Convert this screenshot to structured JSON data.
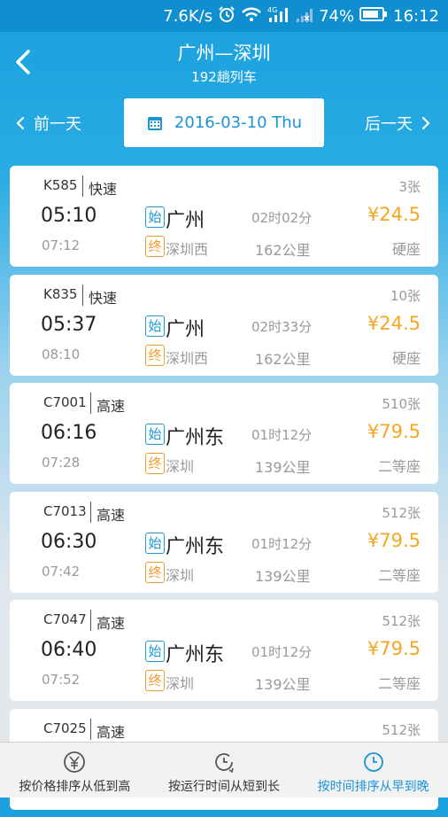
{
  "status_bar": {
    "speed": "7.6K/s",
    "battery": "74%",
    "time": "16:12"
  },
  "header": {
    "title": "广州—深圳",
    "subtitle": "192趟列车"
  },
  "date_nav": {
    "prev_label": "前一天",
    "date": "2016-03-10 Thu",
    "next_label": "后一天"
  },
  "trains": [
    {
      "number": "K585",
      "type": "快速",
      "tickets": "3张",
      "depart": "05:10",
      "arrive": "07:12",
      "start_badge": "始",
      "end_badge": "终",
      "from": "广州",
      "to": "深圳西",
      "duration": "02时02分",
      "distance": "162公里",
      "price": "¥24.5",
      "seat": "硬座"
    },
    {
      "number": "K835",
      "type": "快速",
      "tickets": "10张",
      "depart": "05:37",
      "arrive": "08:10",
      "start_badge": "始",
      "end_badge": "终",
      "from": "广州",
      "to": "深圳西",
      "duration": "02时33分",
      "distance": "162公里",
      "price": "¥24.5",
      "seat": "硬座"
    },
    {
      "number": "C7001",
      "type": "高速",
      "tickets": "510张",
      "depart": "06:16",
      "arrive": "07:28",
      "start_badge": "始",
      "end_badge": "终",
      "from": "广州东",
      "to": "深圳",
      "duration": "01时12分",
      "distance": "139公里",
      "price": "¥79.5",
      "seat": "二等座"
    },
    {
      "number": "C7013",
      "type": "高速",
      "tickets": "512张",
      "depart": "06:30",
      "arrive": "07:42",
      "start_badge": "始",
      "end_badge": "终",
      "from": "广州东",
      "to": "深圳",
      "duration": "01时12分",
      "distance": "139公里",
      "price": "¥79.5",
      "seat": "二等座"
    },
    {
      "number": "C7047",
      "type": "高速",
      "tickets": "512张",
      "depart": "06:40",
      "arrive": "07:52",
      "start_badge": "始",
      "end_badge": "终",
      "from": "广州东",
      "to": "深圳",
      "duration": "01时12分",
      "distance": "139公里",
      "price": "¥79.5",
      "seat": "二等座"
    },
    {
      "number": "C7025",
      "type": "高速",
      "tickets": "512张",
      "depart": "",
      "arrive": "",
      "start_badge": "",
      "end_badge": "",
      "from": "",
      "to": "",
      "duration": "",
      "distance": "",
      "price": "",
      "seat": ""
    }
  ],
  "sort_bar": [
    {
      "label": "按价格排序从低到高",
      "icon": "yuan-icon",
      "active": false
    },
    {
      "label": "按运行时间从短到长",
      "icon": "clock-arrow-icon",
      "active": false
    },
    {
      "label": "按时间排序从早到晚",
      "icon": "clock-icon",
      "active": true
    }
  ],
  "colors": {
    "header_blue": "#1aa0dd",
    "accent_blue": "#1a93d6",
    "price_orange": "#f5a623",
    "end_badge_orange": "#f39c2c"
  }
}
